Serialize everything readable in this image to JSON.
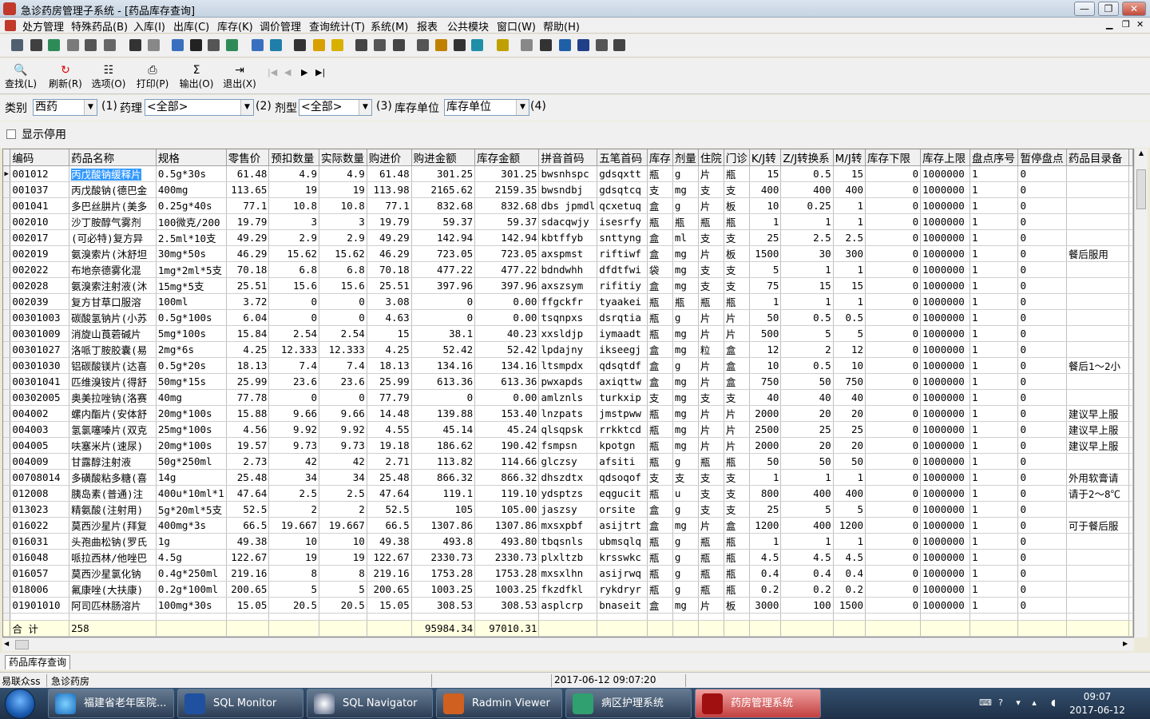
{
  "window": {
    "title": "急诊药房管理子系统 - [药品库存查询]"
  },
  "menus": [
    "处方管理",
    "特殊药品(B)",
    "入库(I)",
    "出库(C)",
    "库存(K)",
    "调价管理",
    "查询统计(T)",
    "系统(M)",
    "报表",
    "公共模块",
    "窗口(W)",
    "帮助(H)"
  ],
  "toolbar": {
    "find": "查找(L)",
    "refresh": "刷新(R)",
    "options": "选项(O)",
    "print": "打印(P)",
    "export": "输出(O)",
    "exit": "退出(X)",
    "nav": [
      "|◀",
      "◀",
      "▶",
      "▶|"
    ]
  },
  "filters": {
    "category_label": "类别",
    "category_value": "西药",
    "n1": "(1)",
    "pharm_label": "药理",
    "pharm_value": "<全部>",
    "n2": "(2)",
    "form_label": "剂型",
    "form_value": "<全部>",
    "n3": "(3)",
    "unit_label": "库存单位",
    "unit_value": "库存单位",
    "n4": "(4)"
  },
  "options": {
    "show_disabled": "显示停用"
  },
  "grid": {
    "columns": [
      "编码",
      "药品名称",
      "规格",
      "零售价",
      "预扣数量",
      "实际数量",
      "购进价",
      "购进金额",
      "库存金额",
      "拼音首码",
      "五笔首码",
      "库存",
      "剂量",
      "住院",
      "门诊",
      "K/J转",
      "Z/J转换系",
      "M/J转",
      "库存下限",
      "库存上限",
      "盘点序号",
      "暂停盘点",
      "药品目录备"
    ],
    "rows": [
      [
        "001012",
        "丙戊酸钠缓释片",
        "0.5g*30s",
        "61.48",
        "4.9",
        "4.9",
        "61.48",
        "301.25",
        "301.25",
        "bwsnhspc",
        "gdsqxtt",
        "瓶",
        "g",
        "片",
        "瓶",
        "15",
        "0.5",
        "15",
        "0",
        "1000000",
        "1",
        "0",
        ""
      ],
      [
        "001037",
        "丙戊酸钠(德巴金",
        "400mg",
        "113.65",
        "19",
        "19",
        "113.98",
        "2165.62",
        "2159.35",
        "bwsndbj",
        "gdsqtcq",
        "支",
        "mg",
        "支",
        "支",
        "400",
        "400",
        "400",
        "0",
        "1000000",
        "1",
        "0",
        ""
      ],
      [
        "001041",
        "多巴丝肼片(美多",
        "0.25g*40s",
        "77.1",
        "10.8",
        "10.8",
        "77.1",
        "832.68",
        "832.68",
        "dbs jpmdl",
        "qcxetuq",
        "盒",
        "g",
        "片",
        "板",
        "10",
        "0.25",
        "1",
        "0",
        "1000000",
        "1",
        "0",
        ""
      ],
      [
        "002010",
        "沙丁胺醇气雾剂",
        "100微克/200",
        "19.79",
        "3",
        "3",
        "19.79",
        "59.37",
        "59.37",
        "sdacqwjy",
        "isesrfy",
        "瓶",
        "瓶",
        "瓶",
        "瓶",
        "1",
        "1",
        "1",
        "0",
        "1000000",
        "1",
        "0",
        ""
      ],
      [
        "002017",
        "(可必特)复方异",
        "2.5ml*10支",
        "49.29",
        "2.9",
        "2.9",
        "49.29",
        "142.94",
        "142.94",
        "kbtffyb",
        "snttyng",
        "盒",
        "ml",
        "支",
        "支",
        "25",
        "2.5",
        "2.5",
        "0",
        "1000000",
        "1",
        "0",
        ""
      ],
      [
        "002019",
        "氨溴索片(沐舒坦",
        "30mg*50s",
        "46.29",
        "15.62",
        "15.62",
        "46.29",
        "723.05",
        "723.05",
        "axspmst",
        "riftiwf",
        "盒",
        "mg",
        "片",
        "板",
        "1500",
        "30",
        "300",
        "0",
        "1000000",
        "1",
        "0",
        "餐后服用"
      ],
      [
        "002022",
        "布地奈德雾化混",
        "1mg*2ml*5支",
        "70.18",
        "6.8",
        "6.8",
        "70.18",
        "477.22",
        "477.22",
        "bdndwhh",
        "dfdtfwi",
        "袋",
        "mg",
        "支",
        "支",
        "5",
        "1",
        "1",
        "0",
        "1000000",
        "1",
        "0",
        ""
      ],
      [
        "002028",
        "氨溴索注射液(沐",
        "15mg*5支",
        "25.51",
        "15.6",
        "15.6",
        "25.51",
        "397.96",
        "397.96",
        "axszsym",
        "rifitiy",
        "盒",
        "mg",
        "支",
        "支",
        "75",
        "15",
        "15",
        "0",
        "1000000",
        "1",
        "0",
        ""
      ],
      [
        "002039",
        "复方甘草口服溶",
        "100ml",
        "3.72",
        "0",
        "0",
        "3.08",
        "0",
        "0.00",
        "ffgckfr",
        "tyaakei",
        "瓶",
        "瓶",
        "瓶",
        "瓶",
        "1",
        "1",
        "1",
        "0",
        "1000000",
        "1",
        "0",
        ""
      ],
      [
        "00301003",
        "碳酸氢钠片(小苏",
        "0.5g*100s",
        "6.04",
        "0",
        "0",
        "4.63",
        "0",
        "0.00",
        "tsqnpxs",
        "dsrqtia",
        "瓶",
        "g",
        "片",
        "片",
        "50",
        "0.5",
        "0.5",
        "0",
        "1000000",
        "1",
        "0",
        ""
      ],
      [
        "00301009",
        "消旋山莨菪碱片",
        "5mg*100s",
        "15.84",
        "2.54",
        "2.54",
        "15",
        "38.1",
        "40.23",
        "xxsldjp",
        "iymaadt",
        "瓶",
        "mg",
        "片",
        "片",
        "500",
        "5",
        "5",
        "0",
        "1000000",
        "1",
        "0",
        ""
      ],
      [
        "00301027",
        "洛哌丁胺胶囊(易",
        "2mg*6s",
        "4.25",
        "12.333",
        "12.333",
        "4.25",
        "52.42",
        "52.42",
        "lpdajny",
        "ikseegj",
        "盒",
        "mg",
        "粒",
        "盒",
        "12",
        "2",
        "12",
        "0",
        "1000000",
        "1",
        "0",
        ""
      ],
      [
        "00301030",
        "铝碳酸镁片(达喜",
        "0.5g*20s",
        "18.13",
        "7.4",
        "7.4",
        "18.13",
        "134.16",
        "134.16",
        "ltsmpdx",
        "qdsqtdf",
        "盒",
        "g",
        "片",
        "盒",
        "10",
        "0.5",
        "10",
        "0",
        "1000000",
        "1",
        "0",
        "餐后1～2小"
      ],
      [
        "00301041",
        "匹维溴铵片(得舒",
        "50mg*15s",
        "25.99",
        "23.6",
        "23.6",
        "25.99",
        "613.36",
        "613.36",
        "pwxapds",
        "axiqttw",
        "盒",
        "mg",
        "片",
        "盒",
        "750",
        "50",
        "750",
        "0",
        "1000000",
        "1",
        "0",
        ""
      ],
      [
        "00302005",
        "奥美拉唑钠(洛赛",
        "40mg",
        "77.78",
        "0",
        "0",
        "77.79",
        "0",
        "0.00",
        "amlznls",
        "turkxip",
        "支",
        "mg",
        "支",
        "支",
        "40",
        "40",
        "40",
        "0",
        "1000000",
        "1",
        "0",
        ""
      ],
      [
        "004002",
        "螺内酯片(安体舒",
        "20mg*100s",
        "15.88",
        "9.66",
        "9.66",
        "14.48",
        "139.88",
        "153.40",
        "lnzpats",
        "jmstpww",
        "瓶",
        "mg",
        "片",
        "片",
        "2000",
        "20",
        "20",
        "0",
        "1000000",
        "1",
        "0",
        "建议早上服"
      ],
      [
        "004003",
        "氢氯噻嗪片(双克",
        "25mg*100s",
        "4.56",
        "9.92",
        "9.92",
        "4.55",
        "45.14",
        "45.24",
        "qlsqpsk",
        "rrkktcd",
        "瓶",
        "mg",
        "片",
        "片",
        "2500",
        "25",
        "25",
        "0",
        "1000000",
        "1",
        "0",
        "建议早上服"
      ],
      [
        "004005",
        "呋塞米片(速尿)",
        "20mg*100s",
        "19.57",
        "9.73",
        "9.73",
        "19.18",
        "186.62",
        "190.42",
        "fsmpsn",
        "kpotgn",
        "瓶",
        "mg",
        "片",
        "片",
        "2000",
        "20",
        "20",
        "0",
        "1000000",
        "1",
        "0",
        "建议早上服"
      ],
      [
        "004009",
        "甘露醇注射液",
        "50g*250ml",
        "2.73",
        "42",
        "42",
        "2.71",
        "113.82",
        "114.66",
        "glczsy",
        "afsiti",
        "瓶",
        "g",
        "瓶",
        "瓶",
        "50",
        "50",
        "50",
        "0",
        "1000000",
        "1",
        "0",
        ""
      ],
      [
        "00708014",
        "多磺酸粘多糖(喜",
        "14g",
        "25.48",
        "34",
        "34",
        "25.48",
        "866.32",
        "866.32",
        "dhszdtx",
        "qdsoqof",
        "支",
        "支",
        "支",
        "支",
        "1",
        "1",
        "1",
        "0",
        "1000000",
        "1",
        "0",
        "外用软膏请"
      ],
      [
        "012008",
        "胰岛素(普通)注",
        "400u*10ml*1",
        "47.64",
        "2.5",
        "2.5",
        "47.64",
        "119.1",
        "119.10",
        "ydsptzs",
        "eqgucit",
        "瓶",
        "u",
        "支",
        "支",
        "800",
        "400",
        "400",
        "0",
        "1000000",
        "1",
        "0",
        "请于2～8℃"
      ],
      [
        "013023",
        "精氨酸(注射用)",
        "5g*20ml*5支",
        "52.5",
        "2",
        "2",
        "52.5",
        "105",
        "105.00",
        "jaszsy",
        "orsite",
        "盒",
        "g",
        "支",
        "支",
        "25",
        "5",
        "5",
        "0",
        "1000000",
        "1",
        "0",
        ""
      ],
      [
        "016022",
        "莫西沙星片(拜复",
        "400mg*3s",
        "66.5",
        "19.667",
        "19.667",
        "66.5",
        "1307.86",
        "1307.86",
        "mxsxpbf",
        "asijtrt",
        "盒",
        "mg",
        "片",
        "盒",
        "1200",
        "400",
        "1200",
        "0",
        "1000000",
        "1",
        "0",
        "可于餐后服"
      ],
      [
        "016031",
        "头孢曲松钠(罗氏",
        "1g",
        "49.38",
        "10",
        "10",
        "49.38",
        "493.8",
        "493.80",
        "tbqsnls",
        "ubmsqlq",
        "瓶",
        "g",
        "瓶",
        "瓶",
        "1",
        "1",
        "1",
        "0",
        "1000000",
        "1",
        "0",
        ""
      ],
      [
        "016048",
        "哌拉西林/他唑巴",
        "4.5g",
        "122.67",
        "19",
        "19",
        "122.67",
        "2330.73",
        "2330.73",
        "plxltzb",
        "krsswkc",
        "瓶",
        "g",
        "瓶",
        "瓶",
        "4.5",
        "4.5",
        "4.5",
        "0",
        "1000000",
        "1",
        "0",
        ""
      ],
      [
        "016057",
        "莫西沙星氯化钠",
        "0.4g*250ml",
        "219.16",
        "8",
        "8",
        "219.16",
        "1753.28",
        "1753.28",
        "mxsxlhn",
        "asijrwq",
        "瓶",
        "g",
        "瓶",
        "瓶",
        "0.4",
        "0.4",
        "0.4",
        "0",
        "1000000",
        "1",
        "0",
        ""
      ],
      [
        "018006",
        "氟康唑(大扶康)",
        "0.2g*100ml",
        "200.65",
        "5",
        "5",
        "200.65",
        "1003.25",
        "1003.25",
        "fkzdfkl",
        "rykdryr",
        "瓶",
        "g",
        "瓶",
        "瓶",
        "0.2",
        "0.2",
        "0.2",
        "0",
        "1000000",
        "1",
        "0",
        ""
      ],
      [
        "01901010",
        "阿司匹林肠溶片",
        "100mg*30s",
        "15.05",
        "20.5",
        "20.5",
        "15.05",
        "308.53",
        "308.53",
        "asplcrp",
        "bnaseit",
        "盒",
        "mg",
        "片",
        "板",
        "3000",
        "100",
        "1500",
        "0",
        "1000000",
        "1",
        "0",
        ""
      ]
    ],
    "summary": {
      "label": "合  计",
      "count": "258",
      "purchase_total": "95984.34",
      "stock_total": "97010.31"
    }
  },
  "tabs": [
    "药品库存查询"
  ],
  "status": {
    "user": "易联众ss",
    "dept": "急诊药房",
    "datetime": "2017-06-12 09:07:20"
  },
  "taskbar": {
    "items": [
      "福建省老年医院...",
      "SQL Monitor",
      "SQL Navigator",
      "Radmin Viewer",
      "病区护理系统",
      "药房管理系统"
    ],
    "time": "09:07",
    "date": "2017-06-12"
  }
}
